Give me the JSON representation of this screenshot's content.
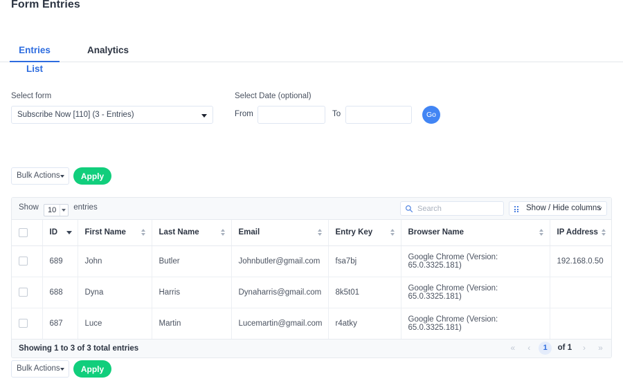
{
  "page": {
    "title": "Form Entries"
  },
  "tabs": [
    {
      "label": "Entries List",
      "active": true
    },
    {
      "label": "Analytics",
      "active": false
    }
  ],
  "filters": {
    "select_form_label": "Select form",
    "select_form_value": "Subscribe Now [110] (3 - Entries)",
    "select_date_label": "Select Date (optional)",
    "from_label": "From",
    "from_value": "",
    "from_placeholder": "",
    "to_label": "To",
    "to_value": "",
    "to_placeholder": "",
    "go_label": "Go"
  },
  "bulk_top": {
    "select_value": "Bulk Actions",
    "apply_label": "Apply"
  },
  "bulk_bottom": {
    "select_value": "Bulk Actions",
    "apply_label": "Apply"
  },
  "table_controls": {
    "show_label": "Show",
    "length_value": "10",
    "entries_label": "entries",
    "search_value": "",
    "search_placeholder": "Search",
    "columns_button_label": "Show / Hide columns"
  },
  "table": {
    "columns": [
      {
        "label": "",
        "sort": "none"
      },
      {
        "label": "ID",
        "sort": "desc"
      },
      {
        "label": "First Name",
        "sort": "both"
      },
      {
        "label": "Last Name",
        "sort": "both"
      },
      {
        "label": "Email",
        "sort": "both"
      },
      {
        "label": "Entry Key",
        "sort": "both"
      },
      {
        "label": "Browser Name",
        "sort": "both"
      },
      {
        "label": "IP Address",
        "sort": "both"
      }
    ],
    "rows": [
      {
        "id": "689",
        "first_name": "John",
        "last_name": "Butler",
        "email": "Johnbutler@gmail.com",
        "entry_key": "fsa7bj",
        "browser_name": "Google Chrome (Version: 65.0.3325.181)",
        "ip_address": "192.168.0.50"
      },
      {
        "id": "688",
        "first_name": "Dyna",
        "last_name": "Harris",
        "email": "Dynaharris@gmail.com",
        "entry_key": "8k5t01",
        "browser_name": "Google Chrome (Version: 65.0.3325.181)",
        "ip_address": ""
      },
      {
        "id": "687",
        "first_name": "Luce",
        "last_name": "Martin",
        "email": "Lucemartin@gmail.com",
        "entry_key": "r4atky",
        "browser_name": "Google Chrome (Version: 65.0.3325.181)",
        "ip_address": ""
      }
    ]
  },
  "footer": {
    "info": "Showing 1 to 3 of 3 total entries",
    "first_label": "«",
    "prev_label": "‹",
    "current_page": "1",
    "of_label": "of 1",
    "next_label": "›",
    "last_label": "»"
  },
  "colors": {
    "accent_blue": "#2d6cdf",
    "go_blue": "#4285f4",
    "apply_green": "#11ce7c",
    "header_text": "#2c3442",
    "body_text": "#4a5260"
  }
}
